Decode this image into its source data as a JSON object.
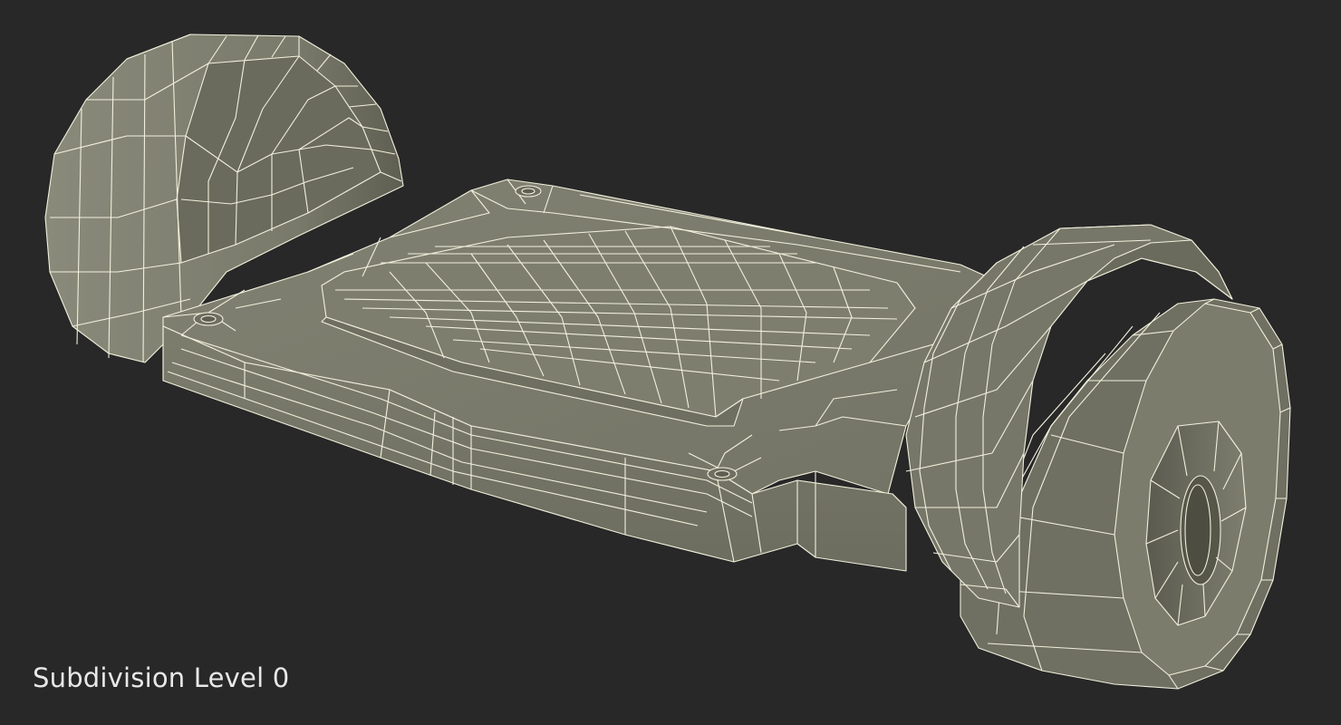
{
  "viewport": {
    "background_color": "#282828",
    "caption": "Subdivision Level 0"
  },
  "model": {
    "subject": "hoverboard wireframe render",
    "surface_color": "#7b7b6c",
    "wire_color": "#f1f0dc"
  }
}
